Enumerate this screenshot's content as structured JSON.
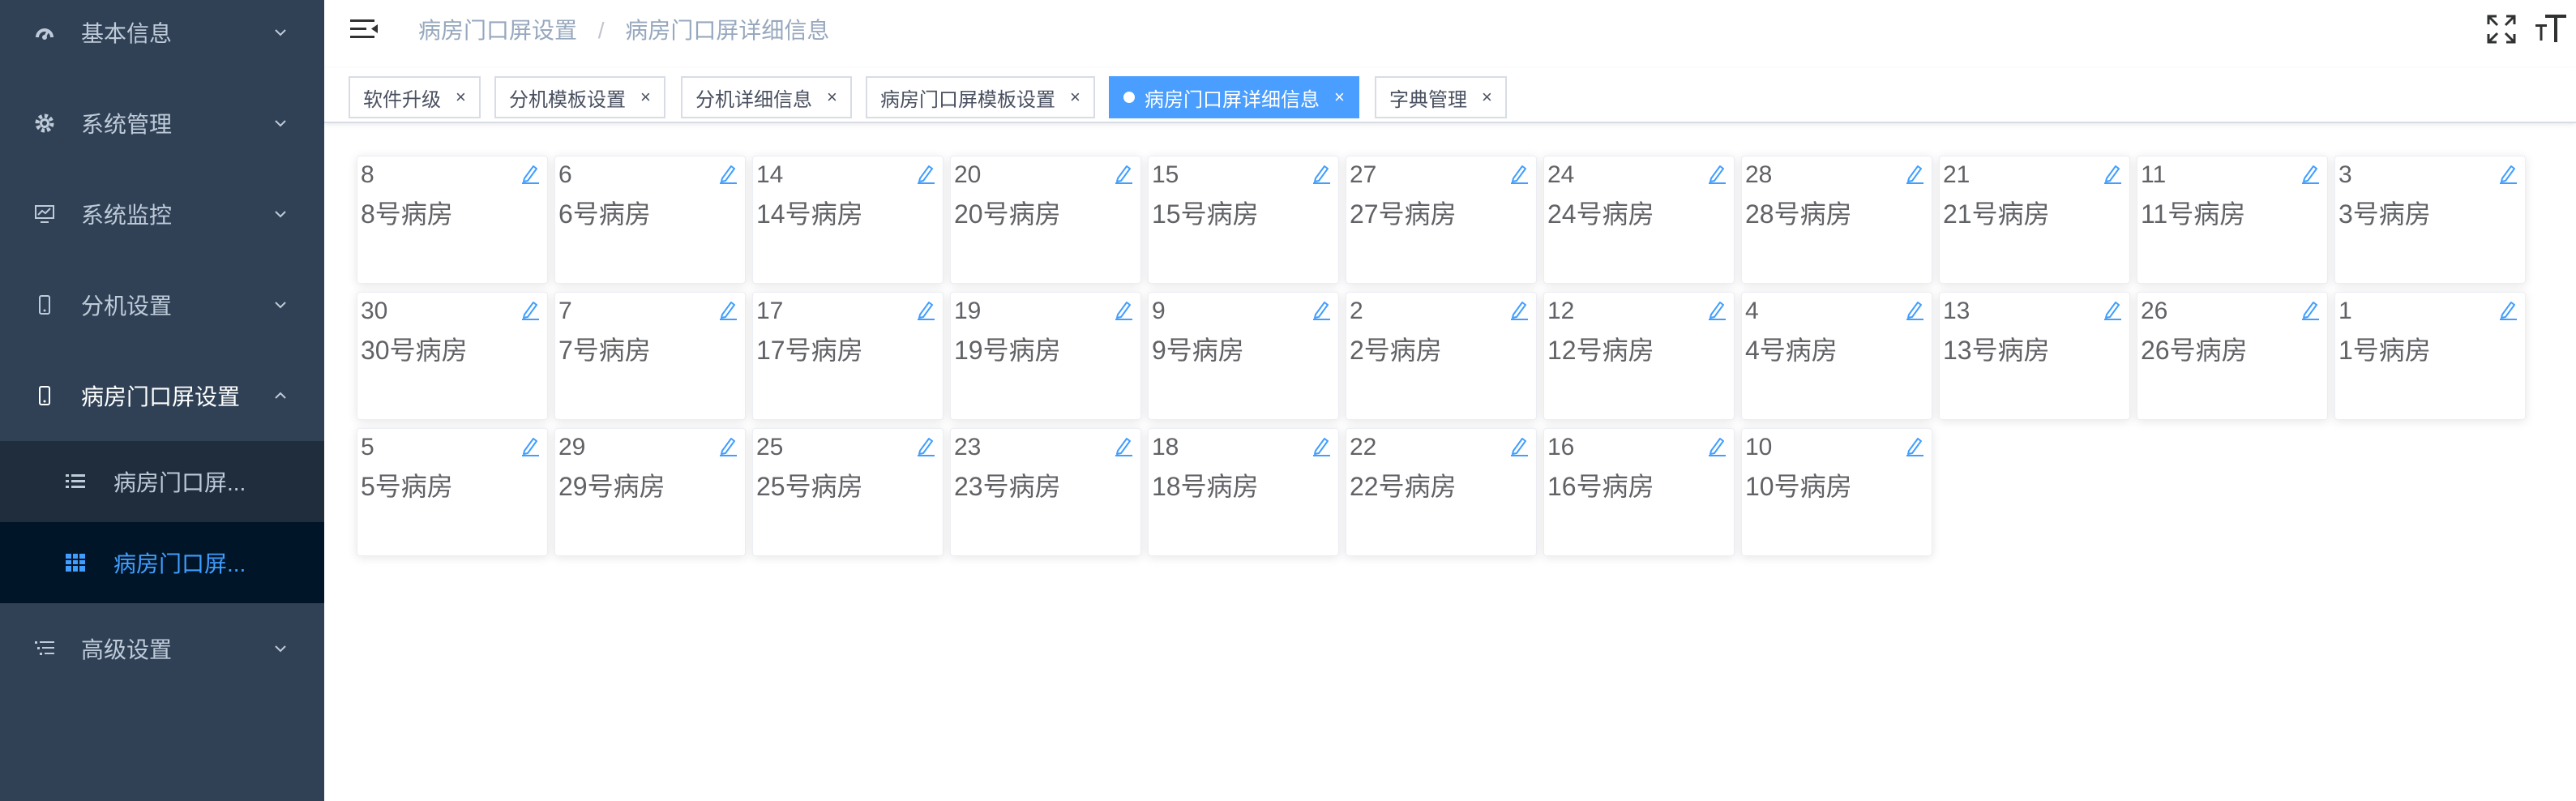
{
  "sidebar": {
    "items": [
      {
        "label": "基本信息",
        "icon": "dashboard-icon"
      },
      {
        "label": "系统管理",
        "icon": "gear-icon"
      },
      {
        "label": "系统监控",
        "icon": "monitor-icon"
      },
      {
        "label": "分机设置",
        "icon": "phone-icon"
      },
      {
        "label": "病房门口屏设置",
        "icon": "phone-icon",
        "expanded": true
      },
      {
        "label": "高级设置",
        "icon": "list-settings-icon"
      }
    ],
    "submenu": [
      {
        "label": "病房门口屏...",
        "icon": "list-icon"
      },
      {
        "label": "病房门口屏...",
        "icon": "grid-icon",
        "active": true
      }
    ]
  },
  "navbar": {
    "breadcrumb": [
      "病房门口屏设置",
      "病房门口屏详细信息"
    ],
    "right_icons": [
      "fullscreen-icon",
      "font-size-icon"
    ]
  },
  "tags": [
    {
      "label": "软件升级",
      "close": "×"
    },
    {
      "label": "分机模板设置",
      "close": "×"
    },
    {
      "label": "分机详细信息",
      "close": "×"
    },
    {
      "label": "病房门口屏模板设置",
      "close": "×"
    },
    {
      "label": "病房门口屏详细信息",
      "close": "×",
      "active": true
    },
    {
      "label": "字典管理",
      "close": "×"
    }
  ],
  "cards": [
    {
      "number": "8",
      "name": "8号病房"
    },
    {
      "number": "6",
      "name": "6号病房"
    },
    {
      "number": "14",
      "name": "14号病房"
    },
    {
      "number": "20",
      "name": "20号病房"
    },
    {
      "number": "15",
      "name": "15号病房"
    },
    {
      "number": "27",
      "name": "27号病房"
    },
    {
      "number": "24",
      "name": "24号病房"
    },
    {
      "number": "28",
      "name": "28号病房"
    },
    {
      "number": "21",
      "name": "21号病房"
    },
    {
      "number": "11",
      "name": "11号病房"
    },
    {
      "number": "3",
      "name": "3号病房"
    },
    {
      "number": "30",
      "name": "30号病房"
    },
    {
      "number": "7",
      "name": "7号病房"
    },
    {
      "number": "17",
      "name": "17号病房"
    },
    {
      "number": "19",
      "name": "19号病房"
    },
    {
      "number": "9",
      "name": "9号病房"
    },
    {
      "number": "2",
      "name": "2号病房"
    },
    {
      "number": "12",
      "name": "12号病房"
    },
    {
      "number": "4",
      "name": "4号病房"
    },
    {
      "number": "13",
      "name": "13号病房"
    },
    {
      "number": "26",
      "name": "26号病房"
    },
    {
      "number": "1",
      "name": "1号病房"
    },
    {
      "number": "5",
      "name": "5号病房"
    },
    {
      "number": "29",
      "name": "29号病房"
    },
    {
      "number": "25",
      "name": "25号病房"
    },
    {
      "number": "23",
      "name": "23号病房"
    },
    {
      "number": "18",
      "name": "18号病房"
    },
    {
      "number": "22",
      "name": "22号病房"
    },
    {
      "number": "16",
      "name": "16号病房"
    },
    {
      "number": "10",
      "name": "10号病房"
    }
  ],
  "colors": {
    "sidebar_bg": "#304156",
    "submenu_bg": "#1f2d3d",
    "submenu_active_bg": "#001528",
    "accent": "#409eff",
    "active_tag": "#4a9eff"
  }
}
